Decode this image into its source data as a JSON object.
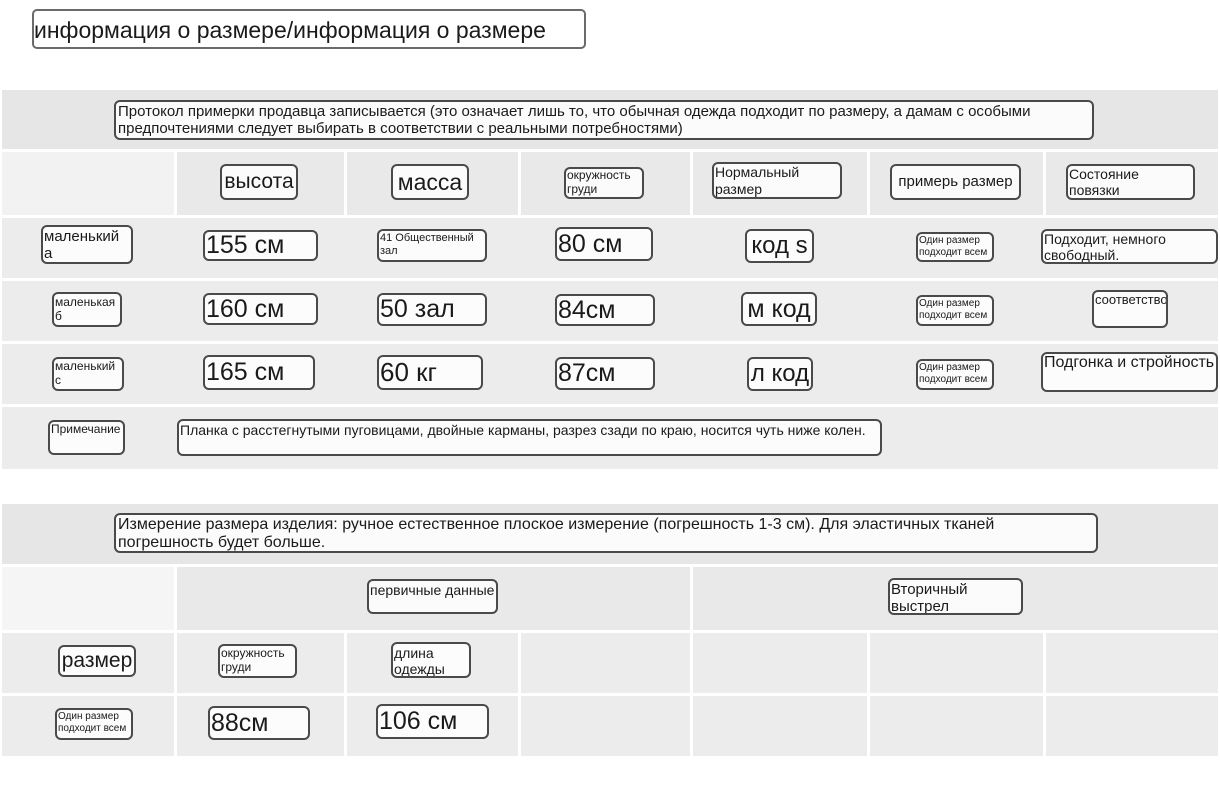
{
  "page": {
    "title": "информация о размере/информация о размере"
  },
  "fit_table": {
    "note_header": "Протокол примерки продавца записывается (это означает лишь то, что обычная одежда подходит по размеру, а дамам с особыми предпочтениями следует выбирать в соответствии с реальными потребностями)",
    "columns": [
      "высота",
      "масса",
      "окружность груди",
      "Нормальный размер",
      "примерь размер",
      "Состояние повязки"
    ],
    "rows": [
      {
        "label": "маленький а",
        "height": "155 см",
        "weight": "41 Общественный зал",
        "chest": "80 см",
        "normal_size": "код s",
        "try_size": "Один размер подходит всем",
        "fit": "Подходит, немного свободный."
      },
      {
        "label": "маленькая б",
        "height": "160 см",
        "weight": "50 зал",
        "chest": "84см",
        "normal_size": "м код",
        "try_size": "Один размер подходит всем",
        "fit": "соответствовать"
      },
      {
        "label": "маленький с",
        "height": "165 см",
        "weight": "60 кг",
        "chest": "87см",
        "normal_size": "л код",
        "try_size": "Один размер подходит всем",
        "fit": "Подгонка и стройность"
      }
    ],
    "remark_label": "Примечание",
    "remark_text": "Планка с расстегнутыми пуговицами, двойные карманы, разрез сзади по краю, носится чуть ниже колен."
  },
  "measure_table": {
    "note_header": "Измерение размера изделия: ручное естественное плоское измерение (погрешность 1-3 см). Для эластичных тканей погрешность будет больше.",
    "group_primary": "первичные данные",
    "group_secondary": "Вторичный выстрел",
    "columns": [
      "размер",
      "окружность груди",
      "длина одежды"
    ],
    "row": {
      "size": "Один размер подходит всем",
      "chest": "88см",
      "length": "106 см"
    }
  },
  "colors": {
    "band": "#e6e6e6",
    "cell": "#efefef",
    "border": "#4a4a4a"
  }
}
